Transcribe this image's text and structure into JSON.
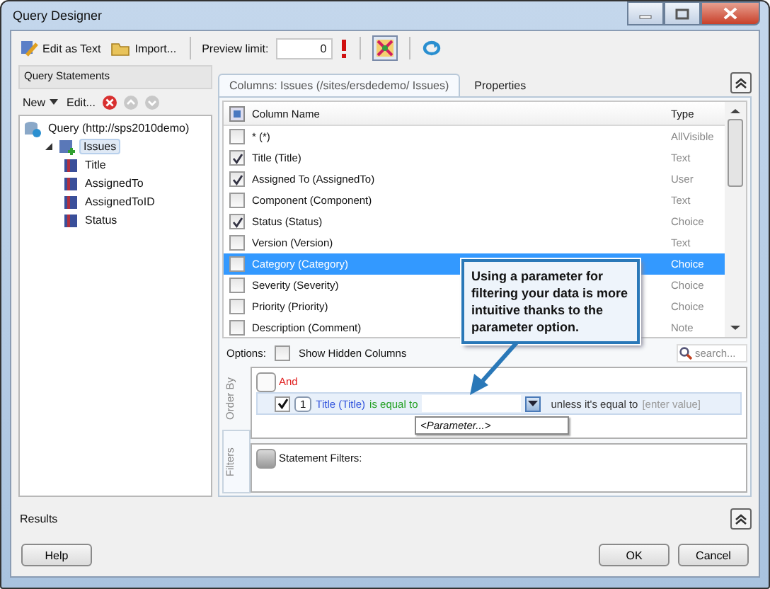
{
  "window": {
    "title": "Query Designer"
  },
  "toolbar": {
    "buttons": [
      {
        "label": "Edit as Text",
        "kind": "edit"
      },
      {
        "label": "Import...",
        "kind": "import"
      }
    ],
    "preview_limit": {
      "label": "Preview limit:",
      "value": "0"
    }
  },
  "query_statements": {
    "title": "Query Statements",
    "new_label": "New",
    "edit_label": "Edit...",
    "tree": [
      {
        "label": "Query (http://sps2010demo)",
        "kind": "query",
        "selected": false,
        "children": [
          {
            "label": "Issues",
            "kind": "list",
            "selected": true,
            "children": [
              {
                "label": "Title",
                "kind": "field",
                "selected": false
              },
              {
                "label": "AssignedTo",
                "kind": "field",
                "selected": false
              },
              {
                "label": "AssignedToID",
                "kind": "field",
                "selected": false
              },
              {
                "label": "Status",
                "kind": "field",
                "selected": false
              }
            ]
          }
        ]
      }
    ]
  },
  "tabs": [
    {
      "label": "Columns: Issues (/sites/ersdedemo/ Issues)",
      "selected": true
    },
    {
      "label": "Properties",
      "selected": false
    }
  ],
  "columns_table": {
    "columns": [
      "Column Name",
      "Type"
    ],
    "select_all_partial": true,
    "rows": [
      {
        "name": "* (*)",
        "type": "AllVisible",
        "checked": false,
        "selected": false
      },
      {
        "name": "Title (Title)",
        "type": "Text",
        "checked": true,
        "selected": false
      },
      {
        "name": "Assigned To (AssignedTo)",
        "type": "User",
        "checked": true,
        "selected": false
      },
      {
        "name": "Component (Component)",
        "type": "Text",
        "checked": false,
        "selected": false
      },
      {
        "name": "Status (Status)",
        "type": "Choice",
        "checked": true,
        "selected": false
      },
      {
        "name": "Version (Version)",
        "type": "Text",
        "checked": false,
        "selected": false
      },
      {
        "name": "Category (Category)",
        "type": "Choice",
        "checked": false,
        "selected": true
      },
      {
        "name": "Severity (Severity)",
        "type": "Choice",
        "checked": false,
        "selected": false
      },
      {
        "name": "Priority (Priority)",
        "type": "Choice",
        "checked": false,
        "selected": false
      },
      {
        "name": "Description (Comment)",
        "type": "Note",
        "checked": false,
        "selected": false
      }
    ]
  },
  "options": {
    "label": "Options:",
    "show_hidden_columns": {
      "label": "Show Hidden Columns",
      "checked": false
    },
    "search": {
      "placeholder": "search..."
    }
  },
  "side_tabs": [
    {
      "label": "Order By",
      "selected": false
    },
    {
      "label": "Filters",
      "selected": true
    }
  ],
  "filters": {
    "group_operator": "And",
    "condition": {
      "checked": true,
      "index": "1",
      "field": "Title (Title)",
      "operator": "is equal to",
      "option": "<Parameter...>",
      "exception": "unless it's equal to",
      "placeholder": "[enter value]"
    },
    "statement_filters": "Statement Filters:"
  },
  "callout": "Using a parameter for filtering your data is more intuitive thanks to the parameter option.",
  "results": {
    "label": "Results"
  },
  "buttons": [
    {
      "label": "Help",
      "kind": "help"
    },
    {
      "label": "OK",
      "kind": "ok"
    },
    {
      "label": "Cancel",
      "kind": "cancel"
    }
  ]
}
